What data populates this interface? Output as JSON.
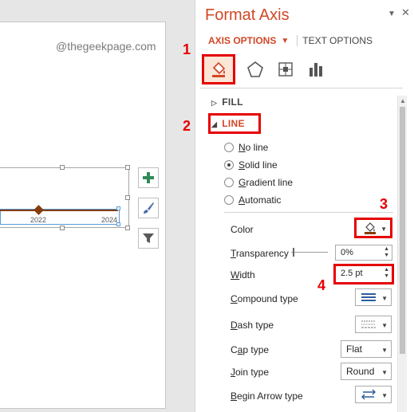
{
  "watermark": "@thegeekpage.com",
  "chart": {
    "tick_labels": [
      "2022",
      "2024"
    ],
    "side_buttons": [
      "chart-elements-icon",
      "chart-styles-icon",
      "chart-filters-icon"
    ]
  },
  "pane": {
    "title": "Format Axis",
    "tabs": {
      "axis_options": "AXIS OPTIONS",
      "text_options": "TEXT OPTIONS"
    },
    "category_icons": [
      "fill-line-icon",
      "effects-pentagon-icon",
      "size-properties-icon",
      "axis-options-chart-icon"
    ],
    "sections": {
      "fill": "FILL",
      "line": "LINE"
    },
    "line_options": [
      {
        "label": "No line",
        "u": "N",
        "rest": "o line",
        "selected": false
      },
      {
        "label": "Solid line",
        "u": "S",
        "rest": "olid line",
        "selected": true
      },
      {
        "label": "Gradient line",
        "u": "G",
        "rest": "radient line",
        "selected": false
      },
      {
        "label": "Automatic",
        "u": "A",
        "rest": "utomatic",
        "selected": false
      }
    ],
    "props": {
      "color_label": "Color",
      "transparency_label": {
        "u": "T",
        "rest": "ransparency"
      },
      "transparency_value": "0%",
      "width_label": {
        "u": "W",
        "rest": "idth"
      },
      "width_value": "2.5 pt",
      "compound_label": {
        "u": "C",
        "rest": "ompound type"
      },
      "dash_label": {
        "u": "D",
        "rest": "ash type"
      },
      "cap_label": {
        "pre": "C",
        "u": "a",
        "rest": "p type"
      },
      "cap_value": "Flat",
      "join_label": {
        "u": "J",
        "rest": "oin type"
      },
      "join_value": "Round",
      "begin_arrow_label": {
        "u": "B",
        "rest": "egin Arrow type"
      }
    },
    "line_color": "#843c0c",
    "accent_color": "#d24726"
  },
  "callouts": [
    "1",
    "2",
    "3",
    "4"
  ]
}
